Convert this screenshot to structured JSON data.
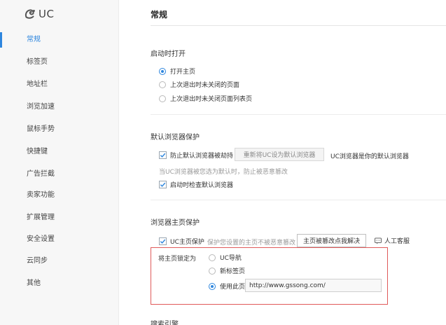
{
  "brand": {
    "logo_text": "UC"
  },
  "sidebar": {
    "items": [
      {
        "label": "常规",
        "active": true
      },
      {
        "label": "标签页"
      },
      {
        "label": "地址栏"
      },
      {
        "label": "浏览加速"
      },
      {
        "label": "鼠标手势"
      },
      {
        "label": "快捷键"
      },
      {
        "label": "广告拦截"
      },
      {
        "label": "卖家功能"
      },
      {
        "label": "扩展管理"
      },
      {
        "label": "安全设置"
      },
      {
        "label": "云同步"
      },
      {
        "label": "其他"
      }
    ]
  },
  "main": {
    "title": "常规",
    "startup": {
      "title": "启动时打开",
      "options": [
        "打开主页",
        "上次退出时未关闭的页面",
        "上次退出时未关闭页面列表页"
      ],
      "selected": 0
    },
    "default_browser": {
      "title": "默认浏览器保护",
      "prevent_hijack_label": "防止默认浏览器被劫持",
      "set_default_button": "重新将UC设为默认浏览器",
      "status_text": "UC浏览器是你的默认浏览器",
      "hint": "当UC浏览器被您选为默认时，防止被恶意篡改",
      "check_on_startup_label": "启动时检查默认浏览器"
    },
    "homepage": {
      "title": "浏览器主页保护",
      "protect_label": "UC主页保护",
      "protect_hint": "保护您设置的主页不被恶意篡改",
      "fix_button": "主页被篡改点我解决",
      "service_label": "人工客服",
      "lock_label": "将主页锁定为",
      "lock_options": [
        "UC导航",
        "新标签页",
        "使用此页"
      ],
      "lock_selected": 2,
      "url_value": "http://www.gssong.com/"
    },
    "next_section_title": "搜索引擎"
  },
  "colors": {
    "accent": "#2e86de",
    "highlight_border": "#e05a5a"
  }
}
